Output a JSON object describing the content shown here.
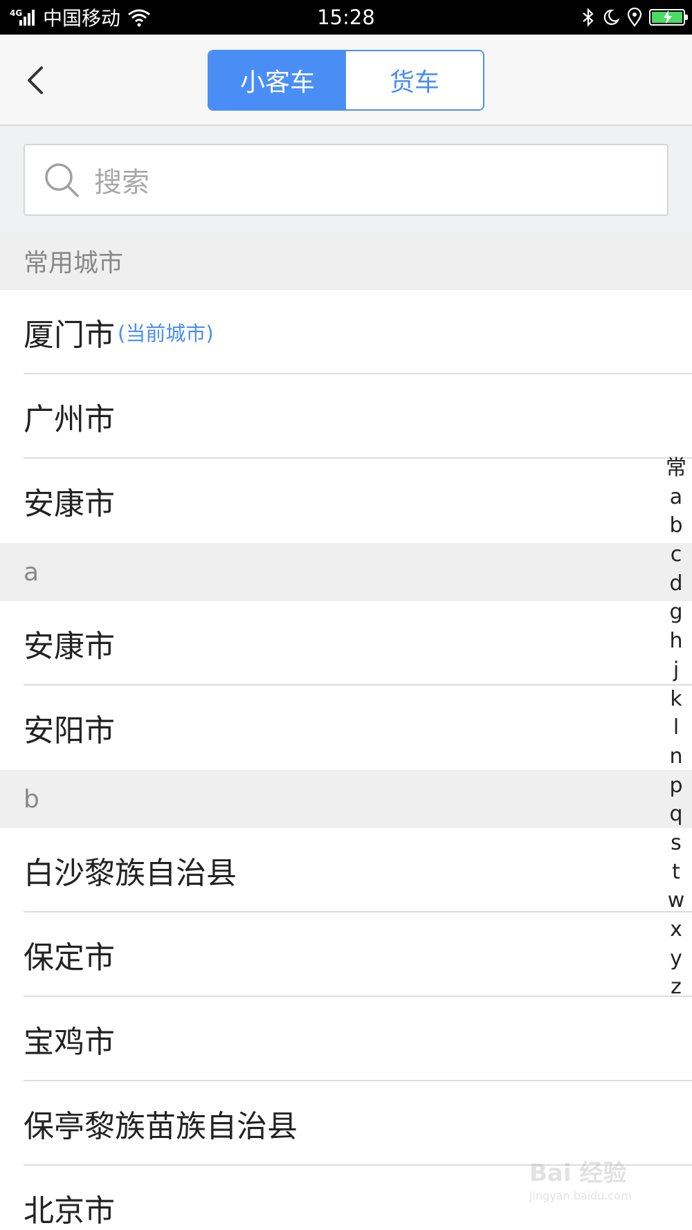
{
  "status_bar": {
    "network": "4G",
    "carrier": "中国移动",
    "time": "15:28",
    "icons": [
      "signal-icon",
      "wifi-icon",
      "bluetooth-icon",
      "moon-icon",
      "location-icon",
      "battery-icon"
    ],
    "battery_level": 1.0,
    "battery_color": "#4cd964"
  },
  "nav": {
    "back_icon": "chevron-left-icon",
    "tabs": [
      {
        "label": "小客车",
        "active": true
      },
      {
        "label": "货车",
        "active": false
      }
    ],
    "accent_color": "#4a8ef5"
  },
  "search": {
    "placeholder": "搜索",
    "icon": "search-icon"
  },
  "list": {
    "frequent_header": "常用城市",
    "frequent": [
      {
        "name": "厦门市",
        "tag": "(当前城市)"
      },
      {
        "name": "广州市"
      },
      {
        "name": "安康市"
      }
    ],
    "section_a": {
      "header": "a",
      "cities": [
        "安康市",
        "安阳市"
      ]
    },
    "section_b": {
      "header": "b",
      "cities": [
        "白沙黎族自治县",
        "保定市",
        "宝鸡市",
        "保亭黎族苗族自治县",
        "北京市"
      ]
    }
  },
  "index": [
    "常",
    "a",
    "b",
    "c",
    "d",
    "g",
    "h",
    "j",
    "k",
    "l",
    "n",
    "p",
    "q",
    "s",
    "t",
    "w",
    "x",
    "y",
    "z"
  ],
  "watermark": {
    "logo": "Bai 经验",
    "url": "jingyan.baidu.com"
  }
}
